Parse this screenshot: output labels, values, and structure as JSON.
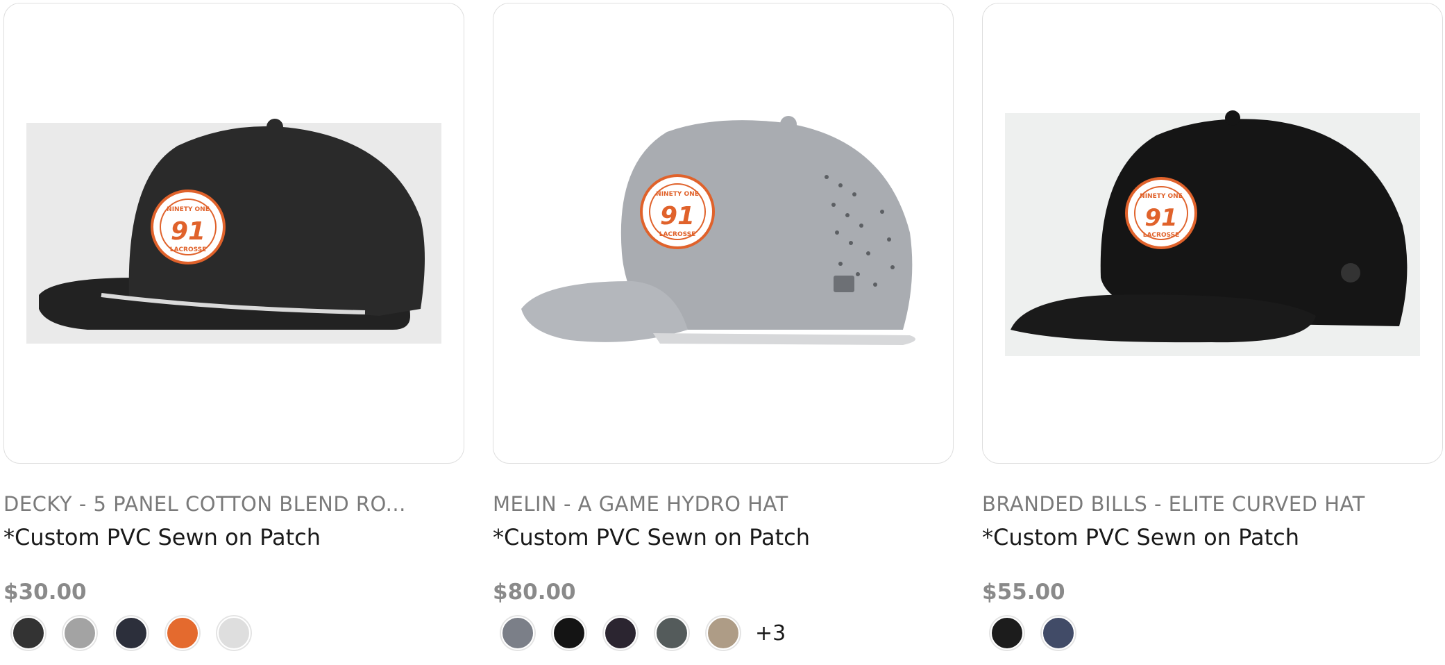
{
  "products": [
    {
      "brand_title": "DECKY - 5 PANEL COTTON BLEND RO...",
      "subtitle": "*Custom PVC Sewn on Patch",
      "price": "$30.00",
      "image_alt": "5 panel rope hat with Ninety One Lacrosse patch",
      "patch_text": {
        "top": "NINETY ONE",
        "number": "91",
        "bottom": "LACROSSE"
      },
      "swatches": [
        "#333333",
        "#a3a3a3",
        "#2c2f3b",
        "#e46a2e",
        "#dedede"
      ],
      "more_label": ""
    },
    {
      "brand_title": "MELIN - A GAME HYDRO HAT",
      "subtitle": "*Custom PVC Sewn on Patch",
      "price": "$80.00",
      "image_alt": "Grey hydro hat with Ninety One Lacrosse patch",
      "patch_text": {
        "top": "NINETY ONE",
        "number": "91",
        "bottom": "LACROSSE"
      },
      "swatches": [
        "#7b7f88",
        "#141414",
        "#2b2530",
        "#545b5b",
        "#ae9c86"
      ],
      "more_label": "+3"
    },
    {
      "brand_title": "BRANDED BILLS - ELITE CURVED HAT",
      "subtitle": "*Custom PVC Sewn on Patch",
      "price": "$55.00",
      "image_alt": "Black elite curved hat with Ninety One Lacrosse patch",
      "patch_text": {
        "top": "NINETY ONE",
        "number": "91",
        "bottom": "LACROSSE"
      },
      "swatches": [
        "#1c1c1c",
        "#414b67"
      ],
      "more_label": ""
    }
  ]
}
